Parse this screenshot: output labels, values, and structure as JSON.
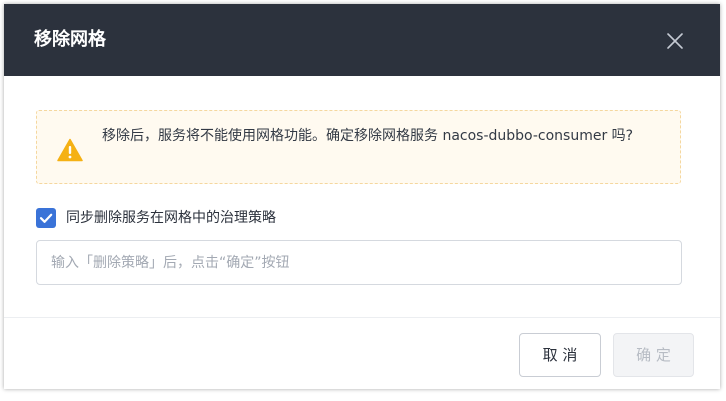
{
  "dialog": {
    "title": "移除网格",
    "close_icon": "close-icon"
  },
  "warning": {
    "icon": "warning-triangle-icon",
    "message": "移除后，服务将不能使用网格功能。确定移除网格服务 nacos-dubbo-consumer 吗?",
    "colors": {
      "background": "#fffaf0",
      "border": "#f5d79e",
      "icon": "#f5b114"
    }
  },
  "sync_delete": {
    "checked": true,
    "label": "同步删除服务在网格中的治理策略"
  },
  "strategy_input": {
    "value": "",
    "placeholder": "输入「删除策略」后，点击“确定”按钮"
  },
  "footer": {
    "cancel_label": "取 消",
    "confirm_label": "确 定",
    "confirm_disabled": true
  },
  "colors": {
    "header": "#2c323d",
    "accent": "#3a73d8"
  }
}
